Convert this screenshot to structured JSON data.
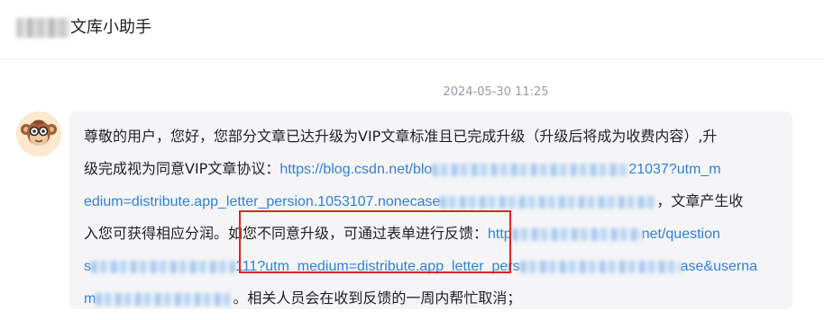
{
  "header": {
    "title": "文库小助手"
  },
  "message": {
    "timestamp": "2024-05-30 11:25",
    "lines": {
      "l1": "尊敬的用户，您好，您部分文章已达升级为VIP文章标准且已完成升级（升级后将成为收费内容）,升",
      "l2_text": "级完成视为同意VIP文章协议：",
      "l2_link_a": "https://blog.csdn.net/blo",
      "l2_link_b": "21037?utm_m",
      "l3_link": "edium=distribute.app_letter_persion.1053107.nonecase",
      "l3_text": "，文章产生收",
      "l4_text": "入您可获得相应分润。如您不同意升级，可通过表单进行反馈：",
      "l4_link_a": "http",
      "l4_link_b": "net/question",
      "l5_link_a": "s",
      "l5_link_b": "111?utm_medium=distribute.app_letter_pers",
      "l5_link_c": "ase&userna",
      "l6_link": "m",
      "l6_text": "。相关人员会在收到反馈的一周内帮忙取消；"
    }
  },
  "colors": {
    "link": "#2f80d8",
    "highlight_border": "#e1251b",
    "bubble_bg": "#f5f5f7"
  },
  "icons": {
    "avatar": "monkey-avatar-icon"
  }
}
